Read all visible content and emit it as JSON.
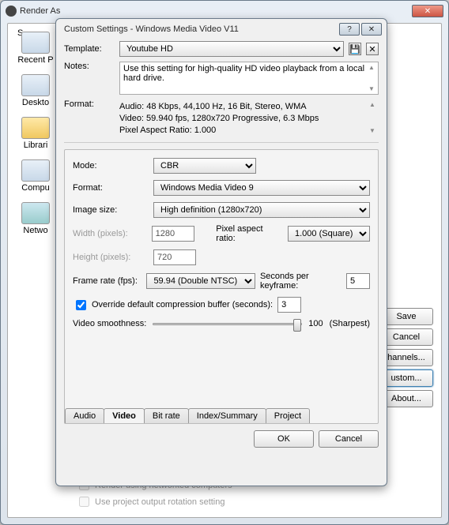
{
  "main_window": {
    "title": "Render As",
    "sidebar": [
      {
        "label": "Recent P"
      },
      {
        "label": "Deskto"
      },
      {
        "label": "Librari"
      },
      {
        "label": "Compu"
      },
      {
        "label": "Netwo"
      }
    ],
    "right_buttons": {
      "save": "Save",
      "cancel": "Cancel",
      "channels": "hannels...",
      "custom": "ustom...",
      "about": "About..."
    },
    "bottom": {
      "render_networked": "Render using networked computers",
      "use_rotation": "Use project output rotation setting"
    }
  },
  "sub_window": {
    "title": "Custom Settings - Windows Media Video V11",
    "template_lbl": "Template:",
    "template_value": "Youtube HD",
    "notes_lbl": "Notes:",
    "notes_value": "Use this setting for high-quality HD video playback from a local hard drive.",
    "format_lbl": "Format:",
    "format_lines": {
      "l1": "Audio: 48 Kbps, 44,100 Hz, 16 Bit, Stereo, WMA",
      "l2": "Video: 59.940 fps, 1280x720 Progressive, 6.3 Mbps",
      "l3": "Pixel Aspect Ratio: 1.000"
    },
    "video_tab": {
      "mode_lbl": "Mode:",
      "mode_value": "CBR",
      "vformat_lbl": "Format:",
      "vformat_value": "Windows Media Video 9",
      "imgsize_lbl": "Image size:",
      "imgsize_value": "High definition (1280x720)",
      "width_lbl": "Width (pixels):",
      "width_value": "1280",
      "par_lbl": "Pixel aspect ratio:",
      "par_value": "1.000 (Square)",
      "height_lbl": "Height (pixels):",
      "height_value": "720",
      "fps_lbl": "Frame rate (fps):",
      "fps_value": "59.94 (Double NTSC)",
      "spk_lbl": "Seconds per keyframe:",
      "spk_value": "5",
      "override_lbl": "Override default compression buffer (seconds):",
      "override_value": "3",
      "smooth_lbl": "Video smoothness:",
      "smooth_value": "100",
      "smooth_suffix": "(Sharpest)"
    },
    "tabs": {
      "audio": "Audio",
      "video": "Video",
      "bitrate": "Bit rate",
      "index": "Index/Summary",
      "project": "Project"
    },
    "footer": {
      "ok": "OK",
      "cancel": "Cancel"
    }
  }
}
